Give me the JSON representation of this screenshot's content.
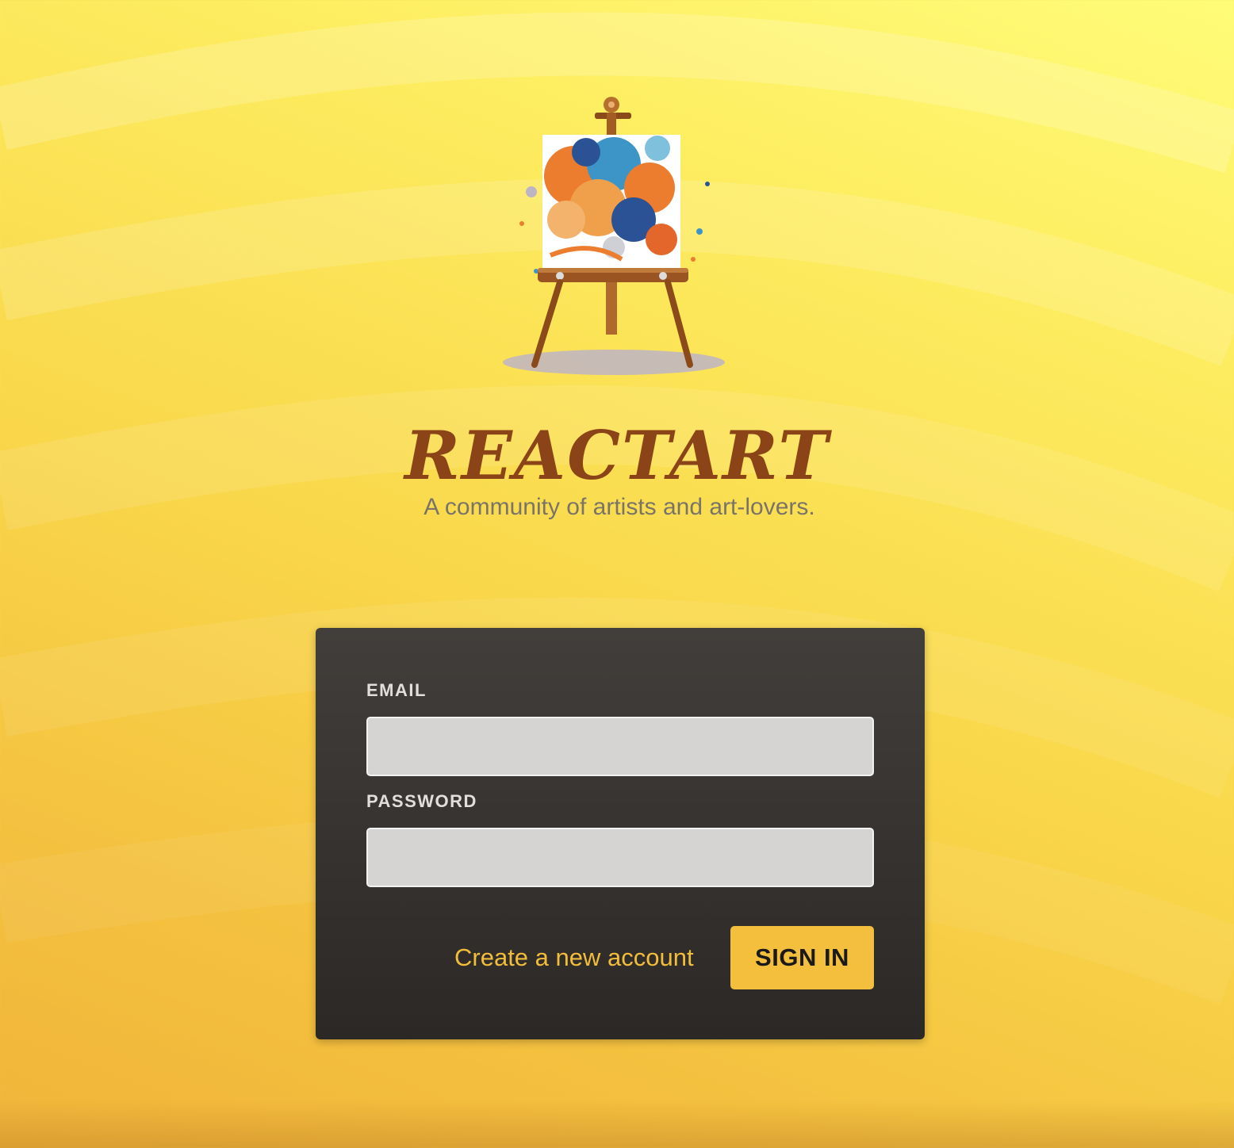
{
  "brand": {
    "title": "REACTART",
    "tagline": "A community of artists and art-lovers.",
    "logo_icon": "easel-painting-icon"
  },
  "login_form": {
    "email_label": "EMAIL",
    "email_value": "",
    "password_label": "PASSWORD",
    "password_value": "",
    "create_account_label": "Create a new account",
    "sign_in_label": "SIGN IN"
  },
  "colors": {
    "background_top": "#fffc78",
    "background_bottom": "#f0b43a",
    "brand_title": "#8a4418",
    "tagline": "#7a7468",
    "card_background": "#3a3633",
    "input_background": "#d5d4d2",
    "accent": "#f4bf3d",
    "link": "#f2bd3a"
  }
}
